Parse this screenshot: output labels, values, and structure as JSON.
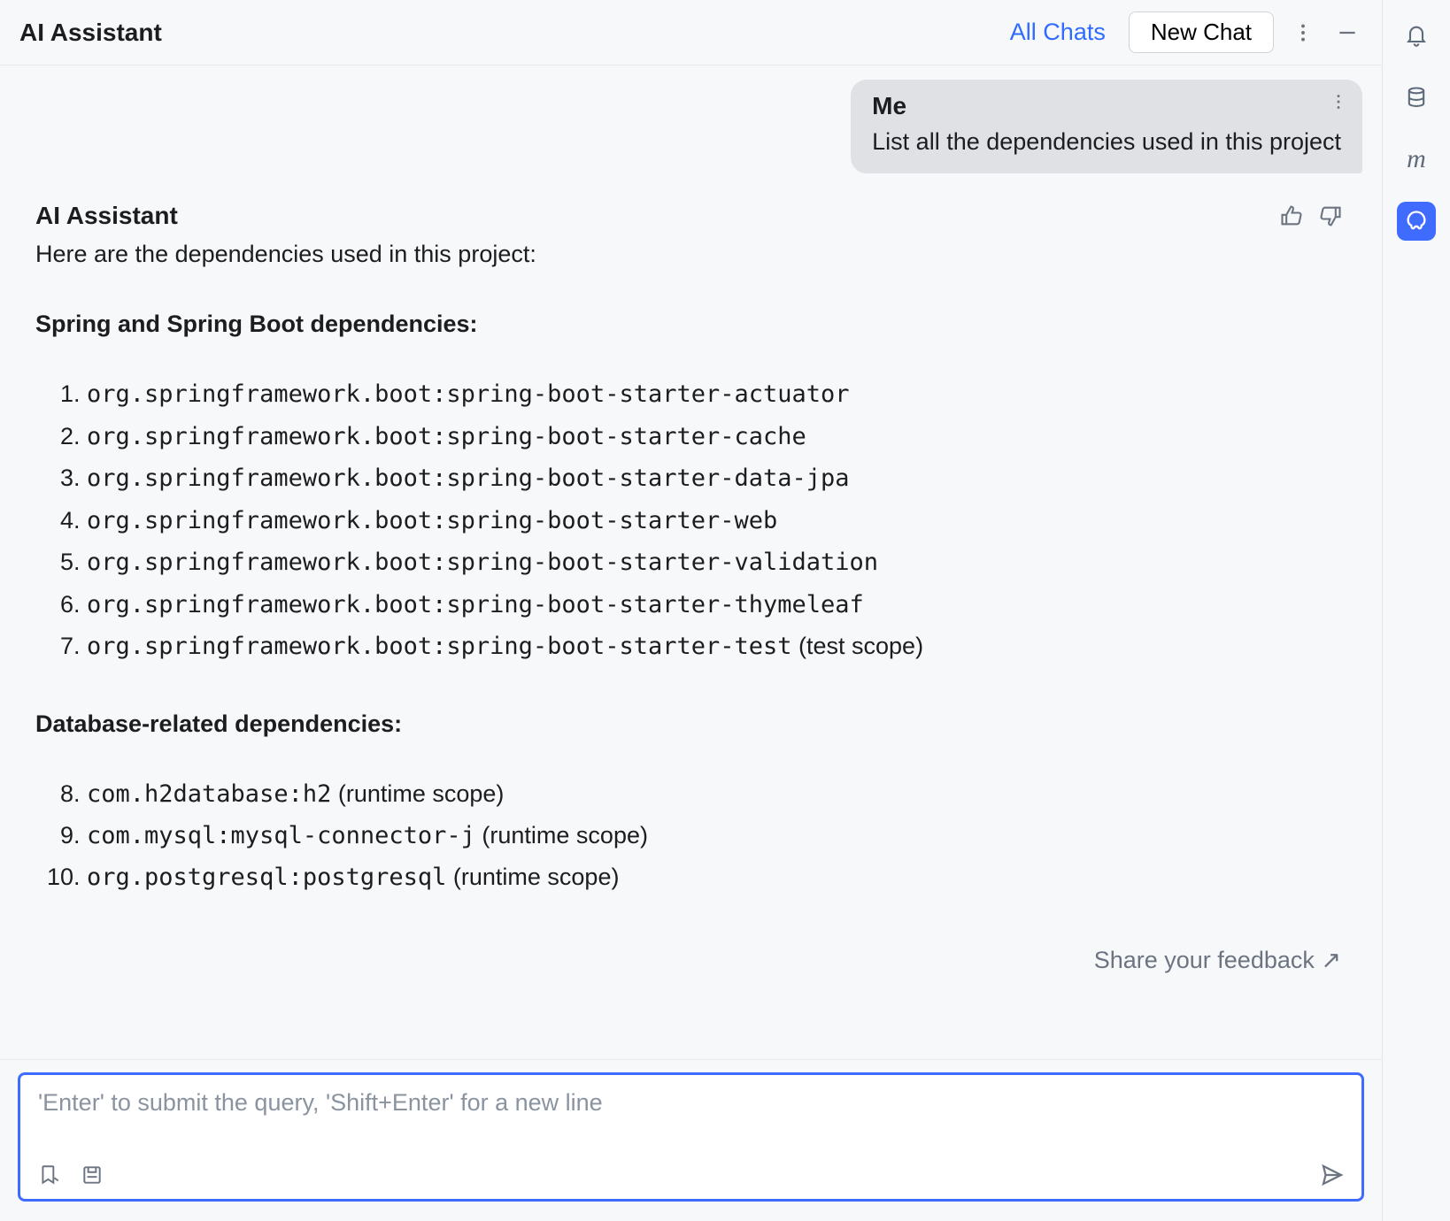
{
  "header": {
    "title": "AI Assistant",
    "all_chats": "All Chats",
    "new_chat": "New Chat"
  },
  "user_message": {
    "sender": "Me",
    "text": "List all the dependencies used in this project"
  },
  "ai_response": {
    "sender": "AI Assistant",
    "intro": "Here are the dependencies used in this project:",
    "sections": [
      {
        "heading": "Spring and Spring Boot dependencies:",
        "start": 1,
        "items": [
          {
            "code": "org.springframework.boot:spring-boot-starter-actuator",
            "suffix": ""
          },
          {
            "code": "org.springframework.boot:spring-boot-starter-cache",
            "suffix": ""
          },
          {
            "code": "org.springframework.boot:spring-boot-starter-data-jpa",
            "suffix": ""
          },
          {
            "code": "org.springframework.boot:spring-boot-starter-web",
            "suffix": ""
          },
          {
            "code": "org.springframework.boot:spring-boot-starter-validation",
            "suffix": ""
          },
          {
            "code": "org.springframework.boot:spring-boot-starter-thymeleaf",
            "suffix": ""
          },
          {
            "code": "org.springframework.boot:spring-boot-starter-test",
            "suffix": " (test scope)"
          }
        ]
      },
      {
        "heading": "Database-related dependencies:",
        "start": 8,
        "items": [
          {
            "code": "com.h2database:h2",
            "suffix": " (runtime scope)"
          },
          {
            "code": "com.mysql:mysql-connector-j",
            "suffix": " (runtime scope)"
          },
          {
            "code": "org.postgresql:postgresql",
            "suffix": " (runtime scope)"
          }
        ]
      }
    ]
  },
  "feedback_link": "Share your feedback ↗",
  "input": {
    "placeholder": "'Enter' to submit the query, 'Shift+Enter' for a new line"
  }
}
